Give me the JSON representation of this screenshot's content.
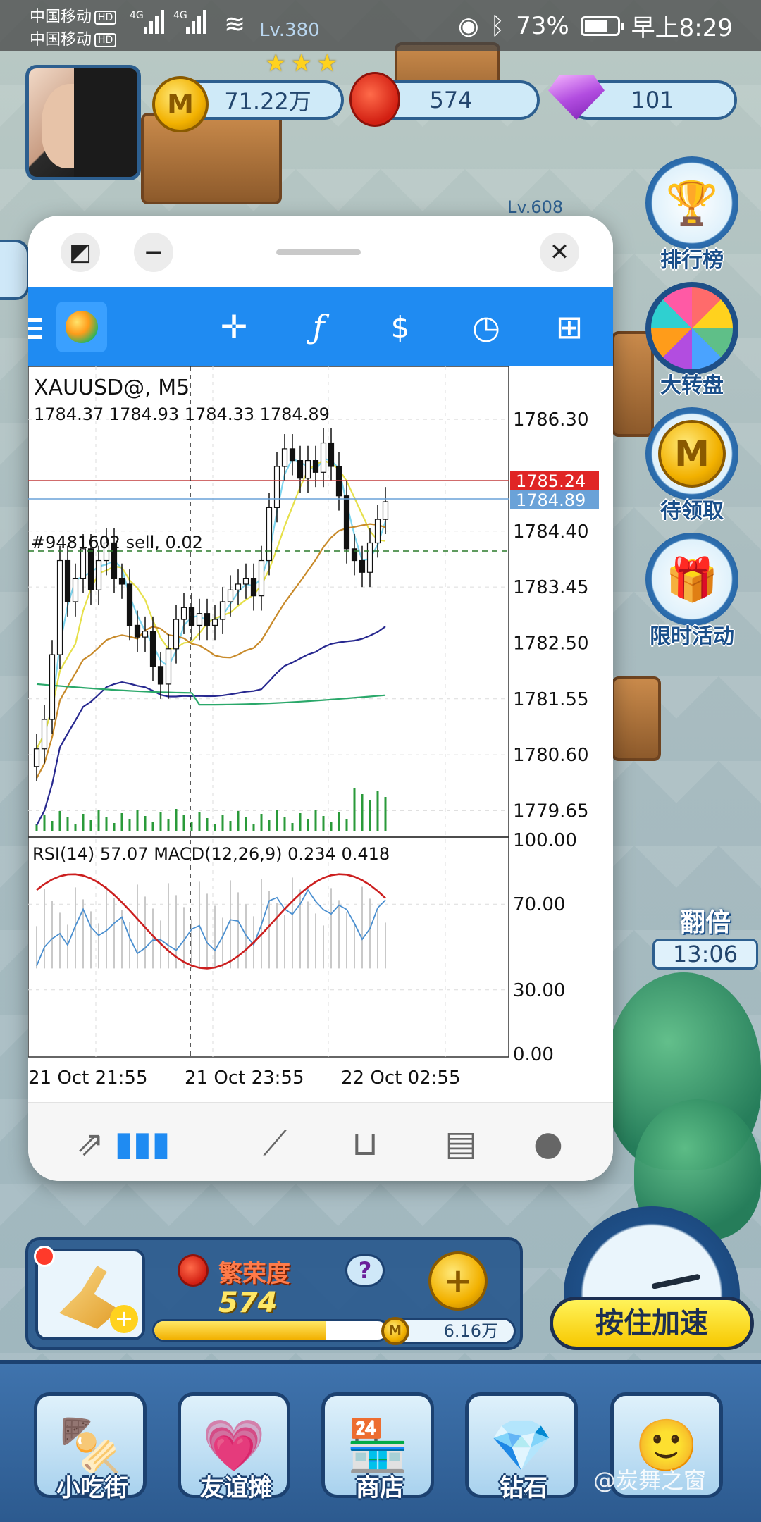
{
  "status_bar": {
    "carrier_1": "中国移动",
    "carrier_2": "中国移动",
    "hd_badge": "HD",
    "network_1": "4G",
    "network_2": "4G",
    "battery_percent": "73%",
    "time": "早上8:29",
    "battery_level": 0.73
  },
  "player": {
    "level_text": "Lv.380",
    "star_count": 3
  },
  "resources": {
    "coins": "71.22万",
    "lanterns": "574",
    "diamonds": "101",
    "coin_symbol": "M"
  },
  "world": {
    "other_level_text": "Lv.608"
  },
  "side_buttons": {
    "leaderboard": "排行榜",
    "wheel": "大转盘",
    "pending": "待领取",
    "limited_event": "限时活动"
  },
  "double_reward": {
    "label": "翻倍",
    "timer": "13:06"
  },
  "mt_window": {
    "symbol_title": "XAUUSD@, M5",
    "ohlc": "1784.37 1784.93 1784.33 1784.89",
    "order_label": "#9481602 sell, 0.02",
    "indicator_label": "RSI(14) 57.07 MACD(12,26,9) 0.234 0.418",
    "ask_price": "1785.24",
    "bid_price": "1784.89",
    "time_labels": [
      "21 Oct 21:55",
      "21 Oct 23:55",
      "22 Oct 02:55"
    ]
  },
  "chart_data": {
    "type": "line",
    "title": "XAUUSD@, M5",
    "price_axis_ticks": [
      "1786.30",
      "1784.40",
      "1783.45",
      "1782.50",
      "1781.55",
      "1780.60",
      "1779.65"
    ],
    "indicator_axis_ticks": [
      "100.00",
      "70.00",
      "30.00",
      "0.00"
    ],
    "x_tick_labels": [
      "21 Oct 21:55",
      "21 Oct 23:55",
      "22 Oct 02:55"
    ],
    "ylim": [
      1779.2,
      1787.2
    ],
    "current_ask": 1785.24,
    "current_bid": 1784.89,
    "order_price": 1783.45,
    "candles_close": [
      1780.7,
      1781.2,
      1782.3,
      1783.9,
      1783.2,
      1783.6,
      1784.1,
      1783.4,
      1783.9,
      1784.2,
      1783.6,
      1783.5,
      1782.8,
      1782.6,
      1782.7,
      1782.1,
      1781.8,
      1782.4,
      1782.9,
      1783.1,
      1782.8,
      1783.0,
      1782.8,
      1782.9,
      1783.2,
      1783.4,
      1783.5,
      1783.6,
      1783.3,
      1783.9,
      1784.8,
      1785.5,
      1785.8,
      1785.6,
      1785.3,
      1785.6,
      1785.4,
      1785.9,
      1785.5,
      1785.0,
      1784.1,
      1783.9,
      1783.7,
      1784.2,
      1784.6,
      1784.9
    ]
  },
  "bottom_toolbar": {
    "icons": [
      "trade-arrows-icon",
      "candlestick-icon",
      "trend-lines-icon",
      "inbox-icon",
      "news-icon",
      "chat-icon"
    ]
  },
  "prosperity": {
    "title": "繁荣度",
    "value": "574",
    "help": "?",
    "progress": 0.74,
    "coin_amount": "6.16万"
  },
  "speed_button": {
    "label": "按住加速"
  },
  "nav": {
    "items": [
      "小吃街",
      "友谊摊",
      "商店",
      "钻石",
      ""
    ]
  },
  "watermark": {
    "text": "@炭舞之窗"
  }
}
